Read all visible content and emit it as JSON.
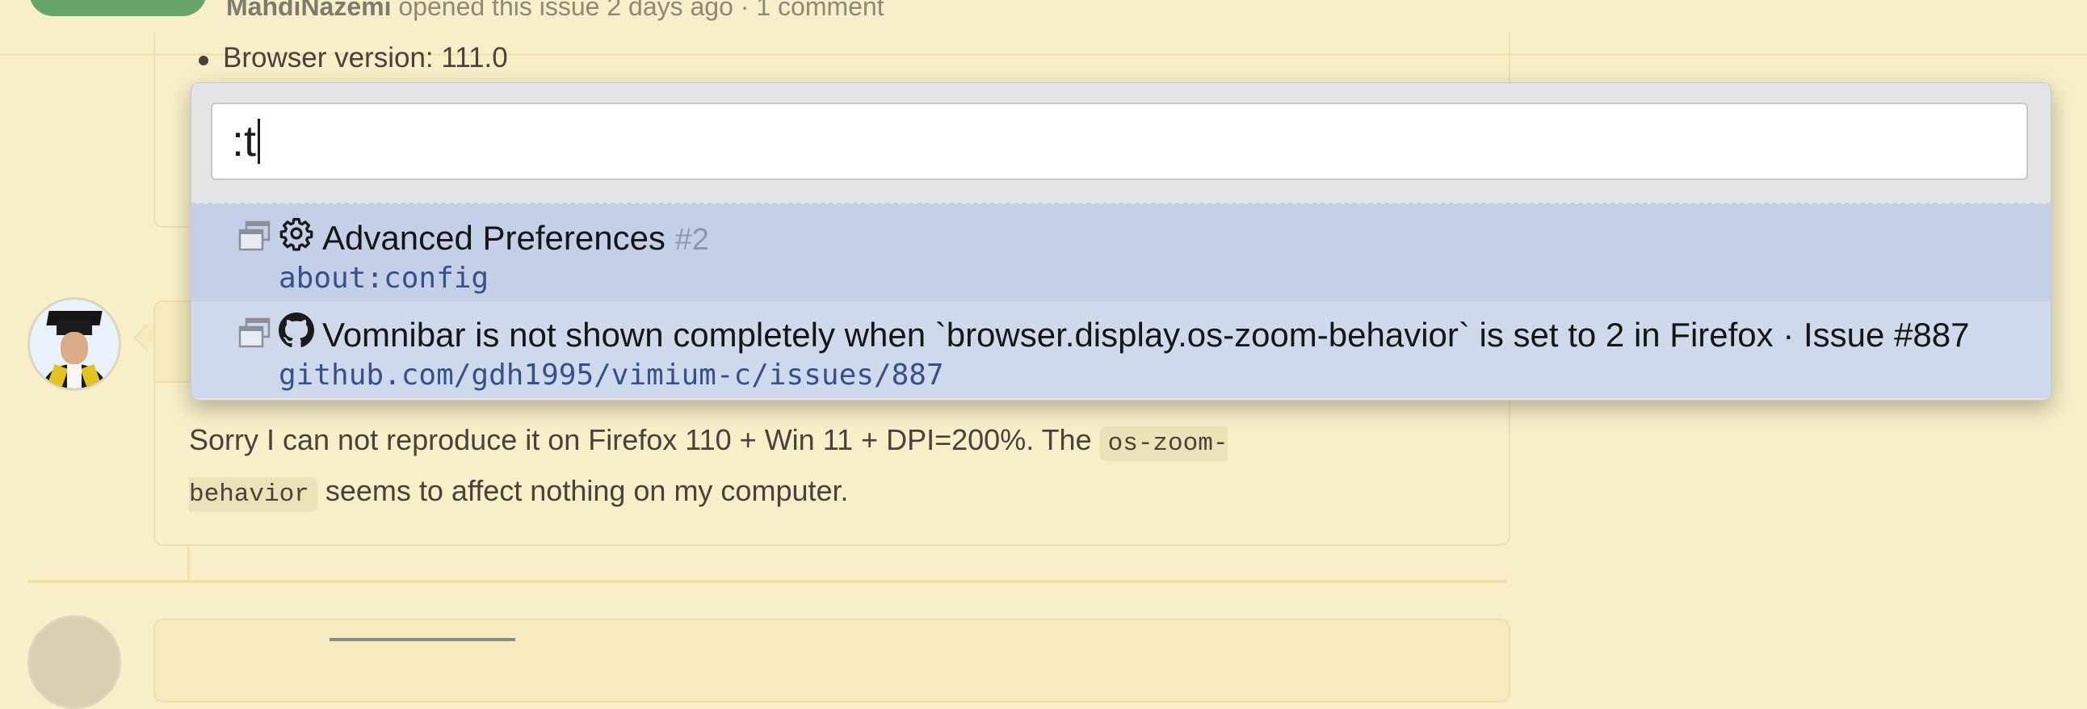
{
  "issue": {
    "author": "MahdiNazemi",
    "opened_text": "opened this issue 2 days ago · 1 comment",
    "bullet_text": "Browser version: 111.0"
  },
  "comment": {
    "text_before": "Sorry I can not reproduce it on Firefox 110 + Win 11 + DPI=200%. The ",
    "code": "os-zoom-behavior",
    "text_after": " seems to affect nothing on my computer."
  },
  "vomnibar": {
    "query": ":t",
    "items": [
      {
        "icon": "gear-icon",
        "title": "Advanced Preferences",
        "tab_number": "#2",
        "url": "about:config"
      },
      {
        "icon": "github-icon",
        "title": "Vomnibar is not shown completely when `browser.display.os-zoom-behavior` is set to 2 in Firefox · Issue #887",
        "url": "github.com/gdh1995/vimium-c/issues/887"
      }
    ]
  },
  "colors": {
    "page_background": "#f8efc8",
    "selected_item": "#c3d0e8",
    "item_background": "#cfd9ec",
    "url_text": "#35508a",
    "status_open": "#67a56b"
  }
}
